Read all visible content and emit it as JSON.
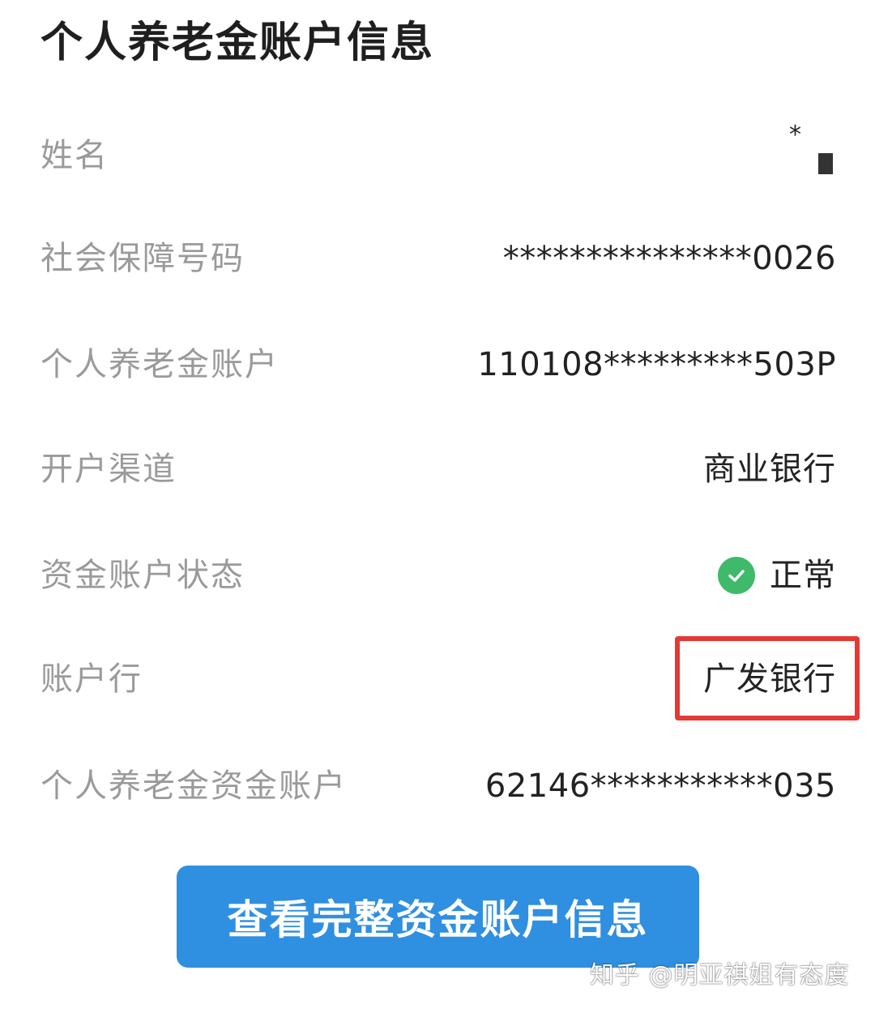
{
  "page": {
    "title": "个人养老金账户信息"
  },
  "fields": {
    "name": {
      "label": "姓名",
      "value_star": "*"
    },
    "social_security_number": {
      "label": "社会保障号码",
      "value": "***************0026"
    },
    "pension_account": {
      "label": "个人养老金账户",
      "value": "110108*********503P"
    },
    "channel": {
      "label": "开户渠道",
      "value": "商业银行"
    },
    "fund_account_status": {
      "label": "资金账户状态",
      "value": "正常",
      "status_color": "#3fb96a",
      "icon": "check-circle-icon"
    },
    "account_bank": {
      "label": "账户行",
      "value": "广发银行",
      "highlight_color": "#e53935"
    },
    "pension_fund_account": {
      "label": "个人养老金资金账户",
      "value": "62146***********035"
    }
  },
  "actions": {
    "view_full_label": "查看完整资金账户信息",
    "button_color": "#2f8fe0"
  },
  "watermark": {
    "text": "知乎 @明亚祺姐有态度"
  }
}
